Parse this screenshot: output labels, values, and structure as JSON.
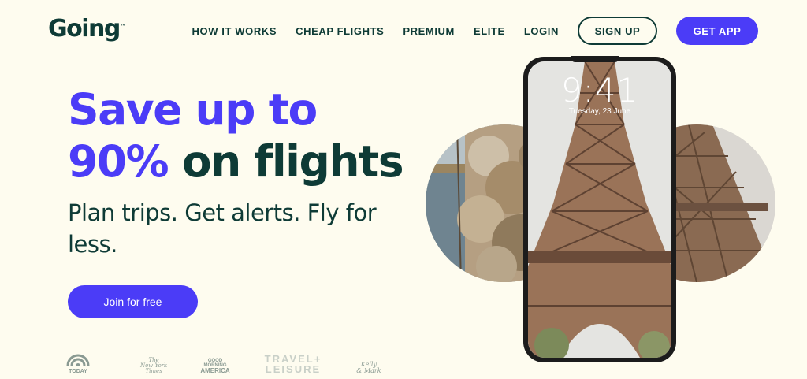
{
  "brand": {
    "name": "Going",
    "tm": "™"
  },
  "nav": {
    "links": [
      "HOW IT WORKS",
      "CHEAP FLIGHTS",
      "PREMIUM",
      "ELITE",
      "LOGIN"
    ],
    "signup": "SIGN UP",
    "get_app": "GET APP"
  },
  "hero": {
    "line1": "Save up to",
    "line2_accent": "90%",
    "line2_rest": "on flights",
    "subhead": "Plan trips. Get alerts. Fly for less.",
    "cta": "Join for free"
  },
  "phone": {
    "time": "9:41",
    "date": "Tuesday, 23 June"
  },
  "press": {
    "today": "TODAY",
    "nyt_line1": "The",
    "nyt_line2": "New York",
    "nyt_line3": "Times",
    "gma_line1": "GOOD",
    "gma_line2": "MORNING",
    "gma_line3": "AMERICA",
    "tl_line1": "TRAVEL+",
    "tl_line2": "LEISURE",
    "km_line1": "Kelly",
    "km_line2": "& Mark"
  },
  "colors": {
    "accent": "#4b3cf7",
    "dark": "#0e3b36",
    "background": "#fefcef"
  }
}
